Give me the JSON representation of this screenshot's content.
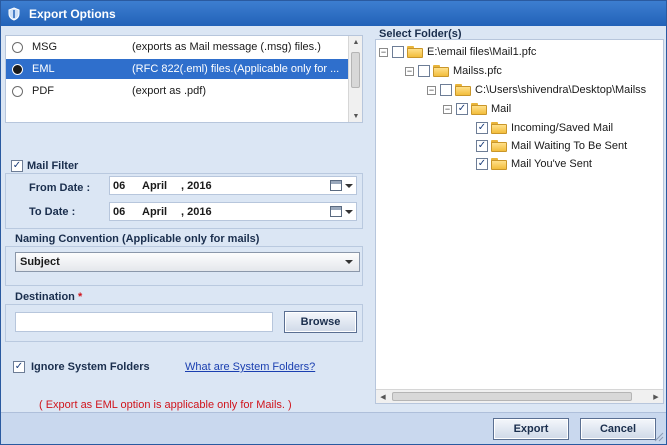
{
  "window": {
    "title": "Export Options"
  },
  "formats": [
    {
      "name": "MSG",
      "desc": "(exports as Mail message (.msg) files.)",
      "selected": false
    },
    {
      "name": "EML",
      "desc": "(RFC 822(.eml) files.(Applicable only for ...",
      "selected": true
    },
    {
      "name": "PDF",
      "desc": "(export as .pdf)",
      "selected": false
    }
  ],
  "mail_filter": {
    "label": "Mail Filter",
    "checked": true,
    "from_label": "From Date :",
    "to_label": "To Date :",
    "from": {
      "day": "06",
      "month": "April",
      "year": ", 2016"
    },
    "to": {
      "day": "06",
      "month": "April",
      "year": ", 2016"
    }
  },
  "naming": {
    "label": "Naming Convention (Applicable only for mails)",
    "selected": "Subject"
  },
  "destination": {
    "label": "Destination",
    "required_mark": "*",
    "value": "",
    "browse_label": "Browse"
  },
  "ignore_system": {
    "label": "Ignore System Folders",
    "checked": true,
    "link": "What are System Folders?"
  },
  "warning": "( Export as EML option is applicable only for Mails. )",
  "folders": {
    "label": "Select Folder(s)",
    "nodes": [
      {
        "label": "E:\\email files\\Mail1.pfc",
        "checked": false
      },
      {
        "label": "Mailss.pfc",
        "checked": false
      },
      {
        "label": "C:\\Users\\shivendra\\Desktop\\Mailss",
        "checked": false
      },
      {
        "label": "Mail",
        "checked": true
      },
      {
        "label": "Incoming/Saved Mail",
        "checked": true
      },
      {
        "label": "Mail Waiting To Be Sent",
        "checked": true
      },
      {
        "label": "Mail You've Sent",
        "checked": true
      }
    ]
  },
  "buttons": {
    "export": "Export",
    "cancel": "Cancel"
  },
  "glyphs": {
    "check": "✓",
    "minus": "−",
    "up": "▲",
    "down": "▼",
    "left": "◀",
    "right": "▶"
  },
  "colors": {
    "titlebar": "#2262b8",
    "selection": "#2f6fcc",
    "warning": "#d0141c",
    "link": "#1a3fb0"
  }
}
